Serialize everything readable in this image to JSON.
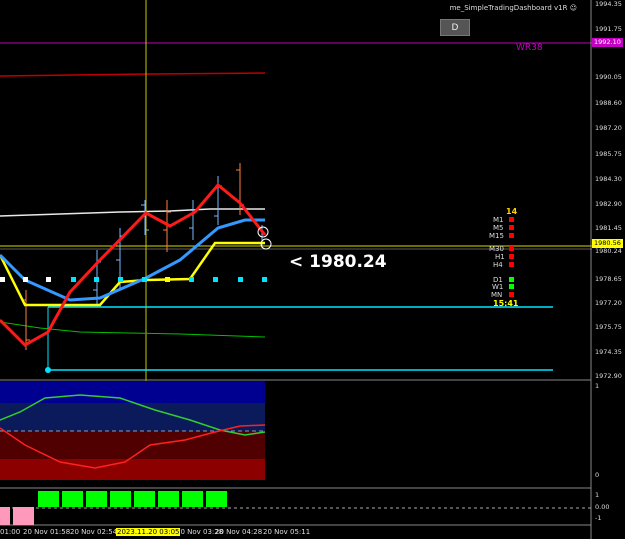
{
  "window": {
    "title": "me_SimpleTradingDashboard v1R",
    "d_button": "D",
    "wr_label": "WR38"
  },
  "price_label": "<  1980.24",
  "timeframes": {
    "count": "14",
    "rows": [
      {
        "label": "M1",
        "color": "#ff0000"
      },
      {
        "label": "M5",
        "color": "#ff0000"
      },
      {
        "label": "M15",
        "color": "#ff0000"
      },
      {
        "label": "M30",
        "color": "#ff0000"
      },
      {
        "label": "H1",
        "color": "#ff0000"
      },
      {
        "label": "H4",
        "color": "#ff0000"
      },
      {
        "label": "D1",
        "color": "#00ff00"
      },
      {
        "label": "W1",
        "color": "#00ff00"
      },
      {
        "label": "MN",
        "color": "#ff0000"
      }
    ],
    "timer": "15:41"
  },
  "price_axis": {
    "ticks": [
      "1994.35",
      "1991.75",
      "1990.05",
      "1988.60",
      "1987.20",
      "1985.75",
      "1984.30",
      "1982.90",
      "1981.45",
      "1980.24",
      "1978.65",
      "1977.20",
      "1975.75",
      "1974.35",
      "1972.90"
    ],
    "tags": {
      "magenta": "1992.10",
      "yellow": "1980.56"
    }
  },
  "osc_axis": {
    "top": "1",
    "bottom": "0"
  },
  "bar_axis": {
    "top": "1",
    "mid": "0.00",
    "bottom": "-1"
  },
  "time_axis": {
    "ticks": [
      "01:00",
      "20 Nov 01:58",
      "20 Nov 02:54",
      "20 Nov 03:28",
      "20 Nov 04:28",
      "20 Nov 05:11"
    ],
    "cursor_label": "2023.11.20 03:05"
  },
  "colors": {
    "accent_red": "#ff0000",
    "accent_yellow": "#ffff00",
    "accent_blue": "#3399ff",
    "accent_cyan": "#00e5ff",
    "accent_green": "#00ff00",
    "accent_magenta": "#c400c4"
  }
}
